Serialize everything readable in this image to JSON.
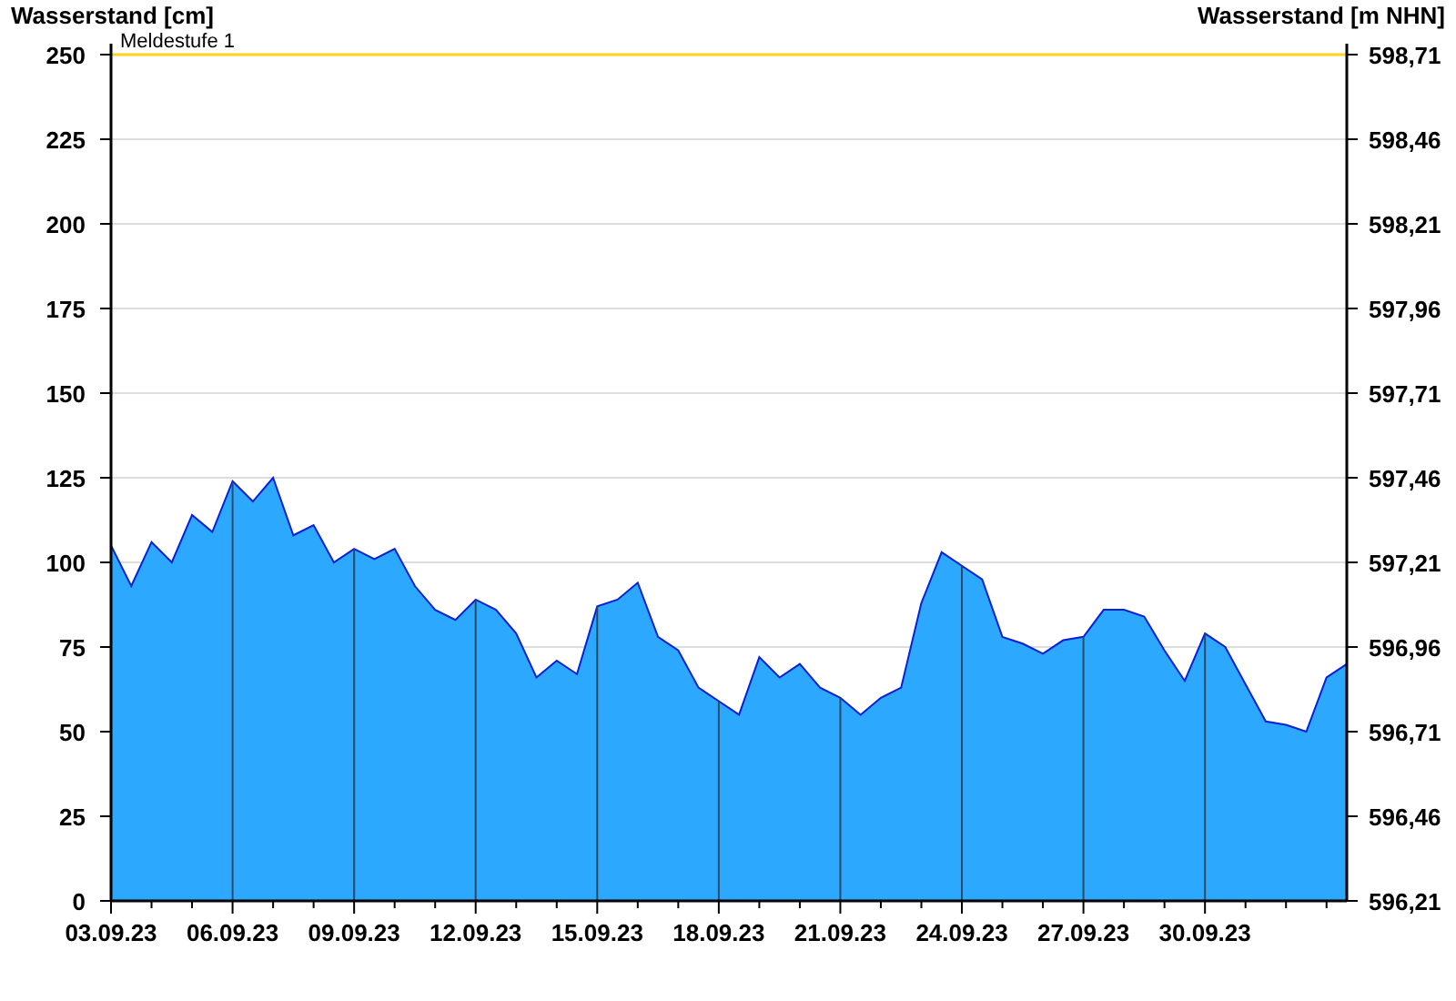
{
  "left_axis_title": "Wasserstand [cm]",
  "right_axis_title": "Wasserstand [m NHN]",
  "right_axis_labels": [
    "598,71",
    "598,46",
    "598,21",
    "597,96",
    "597,71",
    "597,46",
    "597,21",
    "596,96",
    "596,71",
    "596,46",
    "596,21"
  ],
  "chart_data": {
    "type": "area",
    "grid": true,
    "ylim": [
      0,
      250
    ],
    "yticks": [
      0,
      25,
      50,
      75,
      100,
      125,
      150,
      175,
      200,
      225,
      250
    ],
    "categories": [
      "03.09.23",
      null,
      null,
      null,
      null,
      null,
      "06.09.23",
      null,
      null,
      null,
      null,
      null,
      "09.09.23",
      null,
      null,
      null,
      null,
      null,
      "12.09.23",
      null,
      null,
      null,
      null,
      null,
      "15.09.23",
      null,
      null,
      null,
      null,
      null,
      "18.09.23",
      null,
      null,
      null,
      null,
      null,
      "21.09.23",
      null,
      null,
      null,
      null,
      null,
      "24.09.23",
      null,
      null,
      null,
      null,
      null,
      "27.09.23",
      null,
      null,
      null,
      null,
      null,
      "30.09.23",
      null,
      null,
      null,
      null,
      null,
      null,
      null
    ],
    "series": [
      {
        "color": "#2ca8ff",
        "values": [
          105,
          93,
          106,
          100,
          114,
          109,
          124,
          118,
          125,
          108,
          111,
          100,
          104,
          101,
          104,
          93,
          86,
          83,
          89,
          86,
          79,
          66,
          71,
          67,
          87,
          89,
          94,
          78,
          74,
          63,
          59,
          55,
          72,
          66,
          70,
          63,
          60,
          55,
          60,
          63,
          88,
          103,
          99,
          95,
          78,
          76,
          73,
          77,
          78,
          86,
          86,
          84,
          74,
          65,
          79,
          75,
          64,
          53,
          52,
          50,
          66,
          70
        ]
      }
    ],
    "ref_lines": [
      {
        "label": "Meldestufe 1",
        "color": "#ffd21f"
      }
    ]
  }
}
